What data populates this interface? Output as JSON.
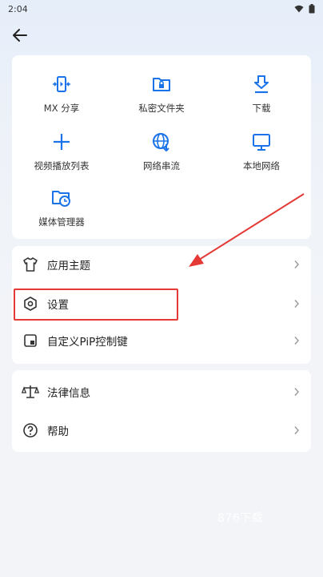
{
  "status_bar": {
    "time": "2:04",
    "icons": [
      "wifi-icon",
      "battery-icon"
    ]
  },
  "header": {
    "back_icon": "arrow-left-icon"
  },
  "grid": {
    "items": [
      {
        "label": "MX 分享",
        "icon": "mx-share-icon"
      },
      {
        "label": "私密文件夹",
        "icon": "private-folder-icon"
      },
      {
        "label": "下载",
        "icon": "download-icon"
      },
      {
        "label": "视频播放列表",
        "icon": "plus-icon"
      },
      {
        "label": "网络串流",
        "icon": "globe-stream-icon"
      },
      {
        "label": "本地网络",
        "icon": "monitor-icon"
      },
      {
        "label": "媒体管理器",
        "icon": "media-manager-icon"
      }
    ]
  },
  "settings_list": {
    "items": [
      {
        "label": "应用主题",
        "icon": "tshirt-icon"
      },
      {
        "label": "设置",
        "icon": "settings-hexagon-icon"
      },
      {
        "label": "自定义PiP控制键",
        "icon": "pip-icon"
      }
    ]
  },
  "info_list": {
    "items": [
      {
        "label": "法律信息",
        "icon": "scale-icon"
      },
      {
        "label": "帮助",
        "icon": "help-circle-icon"
      }
    ]
  },
  "colors": {
    "accent": "#1a73e8",
    "annotation": "#e53935"
  },
  "watermark": "876下载"
}
